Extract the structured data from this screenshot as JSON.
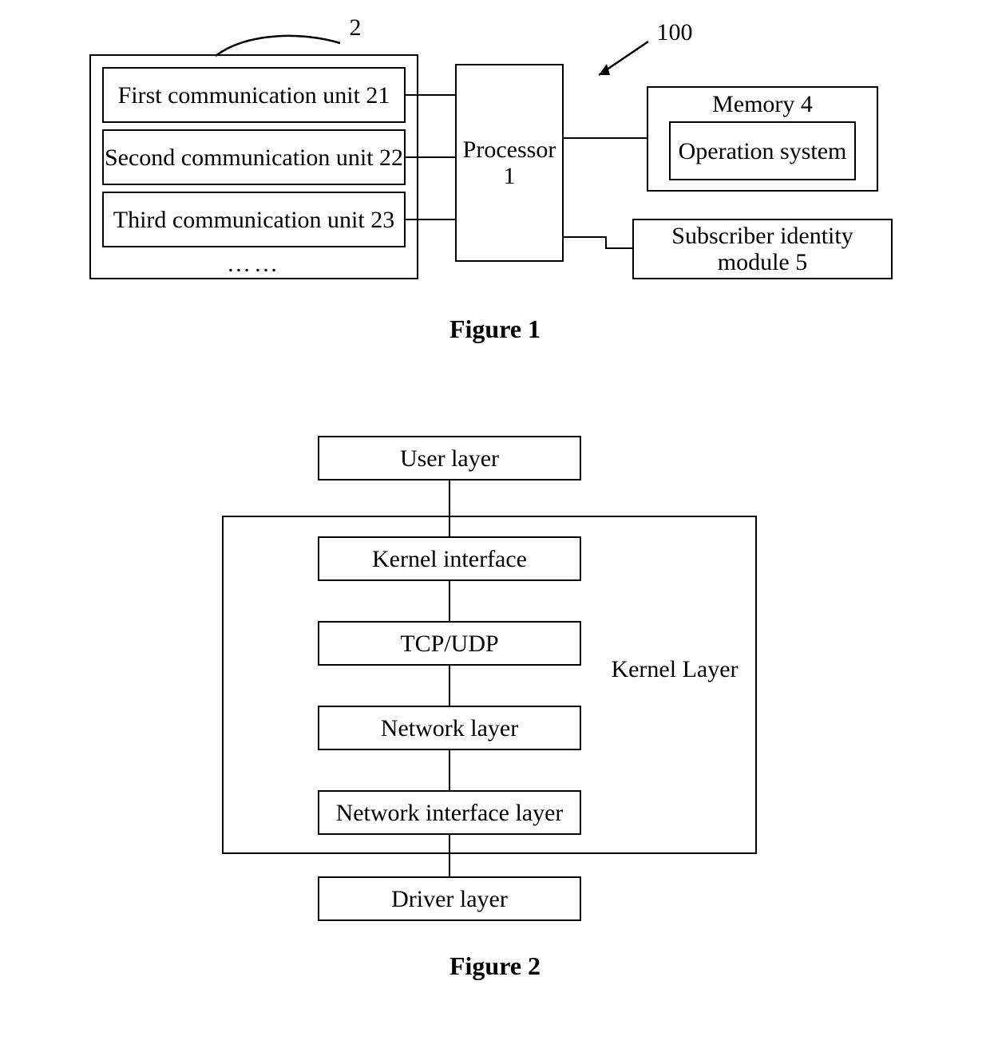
{
  "fig1": {
    "caption": "Figure 1",
    "ref_cu": "2",
    "ref_sys": "100",
    "comm_units": {
      "first": "First communication unit 21",
      "second": "Second communication unit 22",
      "third": "Third communication unit 23",
      "more": "……"
    },
    "processor": "Processor 1",
    "memory": {
      "title": "Memory 4",
      "item": "Operation system"
    },
    "sim": "Subscriber identity module 5"
  },
  "fig2": {
    "caption": "Figure 2",
    "user_layer": "User layer",
    "kernel_label": "Kernel Layer",
    "kernel_interface": "Kernel interface",
    "tcp_udp": "TCP/UDP",
    "network_layer": "Network layer",
    "nil": "Network interface layer",
    "driver_layer": "Driver layer"
  }
}
